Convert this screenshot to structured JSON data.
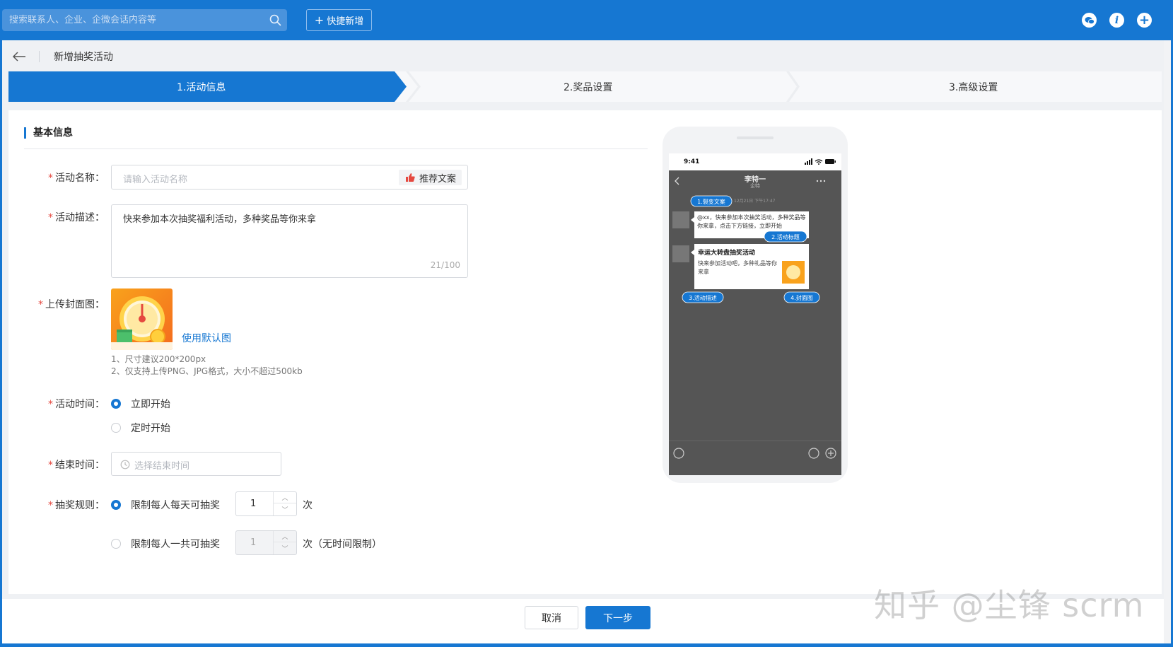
{
  "topbar": {
    "search_placeholder": "搜索联系人、企业、企微会话内容等",
    "quick_add_label": "快捷新增",
    "icons": [
      "wechat-icon",
      "info-icon",
      "add-icon"
    ]
  },
  "page": {
    "title": "新增抽奖活动"
  },
  "steps": [
    {
      "label": "1.活动信息",
      "active": true
    },
    {
      "label": "2.奖品设置",
      "active": false
    },
    {
      "label": "3.高级设置",
      "active": false
    }
  ],
  "form": {
    "section_title": "基本信息",
    "name": {
      "label": "活动名称：",
      "placeholder": "请输入活动名称",
      "recommend_label": "推荐文案"
    },
    "description": {
      "label": "活动描述：",
      "value": "快来参加本次抽奖福利活动，多种奖品等你来拿",
      "counter": "21/100"
    },
    "cover": {
      "label": "上传封面图：",
      "default_link": "使用默认图",
      "hint1": "1、尺寸建议200*200px",
      "hint2": "2、仅支持上传PNG、JPG格式，大小不超过500kb"
    },
    "time": {
      "label": "活动时间：",
      "option1": "立即开始",
      "option2": "定时开始",
      "selected": 0
    },
    "end_time": {
      "label": "结束时间：",
      "placeholder": "选择结束时间"
    },
    "rule": {
      "label": "抽奖规则：",
      "option1": "限制每人每天可抽奖",
      "option1_value": "1",
      "option1_unit": "次",
      "option2": "限制每人一共可抽奖",
      "option2_value": "1",
      "option2_unit": "次（无时间限制）",
      "selected": 0
    }
  },
  "preview": {
    "time": "9:41",
    "contact_name": "李特一",
    "contact_sub": "企特",
    "timestamp": "12月21日 下午17:47",
    "msg1": "@xx，快来参加本次抽奖活动，多种奖品等你来拿，点击下方链接，立即开始",
    "card_title": "幸运大转盘抽奖活动",
    "card_desc": "快来参加活动吧，多种礼品等你来拿",
    "tag1": "1.裂变文案",
    "tag2": "2.活动标题",
    "tag3": "3.活动描述",
    "tag4": "4.封面图"
  },
  "footer": {
    "cancel_label": "取消",
    "next_label": "下一步"
  },
  "watermark": "知乎 @尘锋 scrm",
  "colors": {
    "accent": "#1677d2",
    "required": "#e5483f"
  }
}
